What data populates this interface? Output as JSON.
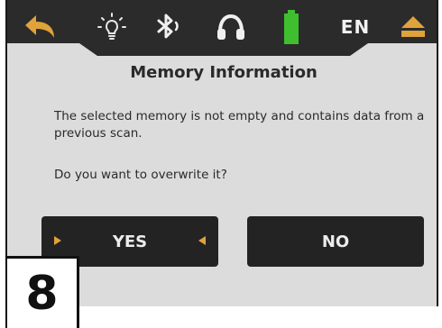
{
  "topbar": {
    "lang": "EN",
    "icons": [
      "back-arrow-icon",
      "lightbulb-icon",
      "bluetooth-icon",
      "headphones-icon",
      "battery-icon",
      "eject-icon"
    ]
  },
  "dialog": {
    "title": "Memory Information",
    "message": "The selected memory is not empty and contains data from a previous scan.",
    "question": "Do you want to overwrite it?"
  },
  "buttons": {
    "yes_label": "YES",
    "no_label": "NO"
  },
  "step_number": "8",
  "colors": {
    "accent": "#e0a23a",
    "battery": "#3fbf2f",
    "bar": "#2b2b2b",
    "screen_bg": "#dcdcdc",
    "button_bg": "#232323"
  }
}
